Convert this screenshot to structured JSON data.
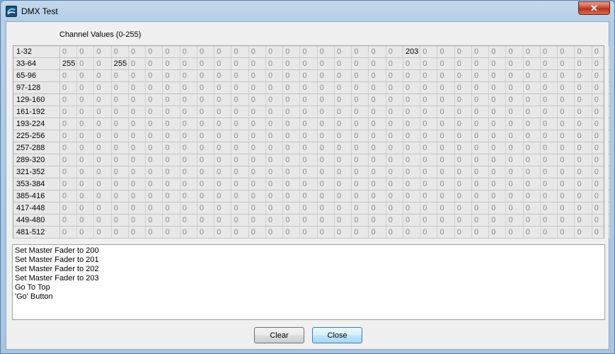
{
  "window": {
    "title": "DMX Test",
    "close_symbol": "✕"
  },
  "grid": {
    "caption": "Channel Values (0-255)",
    "rows": [
      {
        "label": "1-32",
        "values": [
          "0",
          "0",
          "0",
          "0",
          "0",
          "0",
          "0",
          "0",
          "0",
          "0",
          "0",
          "0",
          "0",
          "0",
          "0",
          "0",
          "0",
          "0",
          "0",
          "0",
          "203",
          "0",
          "0",
          "0",
          "0",
          "0",
          "0",
          "0",
          "0",
          "0",
          "0",
          "0"
        ]
      },
      {
        "label": "33-64",
        "values": [
          "255",
          "0",
          "0",
          "255",
          "0",
          "0",
          "0",
          "0",
          "0",
          "0",
          "0",
          "0",
          "0",
          "0",
          "0",
          "0",
          "0",
          "0",
          "0",
          "0",
          "0",
          "0",
          "0",
          "0",
          "0",
          "0",
          "0",
          "0",
          "0",
          "0",
          "0",
          "0"
        ]
      },
      {
        "label": "65-96",
        "values": [
          "0",
          "0",
          "0",
          "0",
          "0",
          "0",
          "0",
          "0",
          "0",
          "0",
          "0",
          "0",
          "0",
          "0",
          "0",
          "0",
          "0",
          "0",
          "0",
          "0",
          "0",
          "0",
          "0",
          "0",
          "0",
          "0",
          "0",
          "0",
          "0",
          "0",
          "0",
          "0"
        ]
      },
      {
        "label": "97-128",
        "values": [
          "0",
          "0",
          "0",
          "0",
          "0",
          "0",
          "0",
          "0",
          "0",
          "0",
          "0",
          "0",
          "0",
          "0",
          "0",
          "0",
          "0",
          "0",
          "0",
          "0",
          "0",
          "0",
          "0",
          "0",
          "0",
          "0",
          "0",
          "0",
          "0",
          "0",
          "0",
          "0"
        ]
      },
      {
        "label": "129-160",
        "values": [
          "0",
          "0",
          "0",
          "0",
          "0",
          "0",
          "0",
          "0",
          "0",
          "0",
          "0",
          "0",
          "0",
          "0",
          "0",
          "0",
          "0",
          "0",
          "0",
          "0",
          "0",
          "0",
          "0",
          "0",
          "0",
          "0",
          "0",
          "0",
          "0",
          "0",
          "0",
          "0"
        ]
      },
      {
        "label": "161-192",
        "values": [
          "0",
          "0",
          "0",
          "0",
          "0",
          "0",
          "0",
          "0",
          "0",
          "0",
          "0",
          "0",
          "0",
          "0",
          "0",
          "0",
          "0",
          "0",
          "0",
          "0",
          "0",
          "0",
          "0",
          "0",
          "0",
          "0",
          "0",
          "0",
          "0",
          "0",
          "0",
          "0"
        ]
      },
      {
        "label": "193-224",
        "values": [
          "0",
          "0",
          "0",
          "0",
          "0",
          "0",
          "0",
          "0",
          "0",
          "0",
          "0",
          "0",
          "0",
          "0",
          "0",
          "0",
          "0",
          "0",
          "0",
          "0",
          "0",
          "0",
          "0",
          "0",
          "0",
          "0",
          "0",
          "0",
          "0",
          "0",
          "0",
          "0"
        ]
      },
      {
        "label": "225-256",
        "values": [
          "0",
          "0",
          "0",
          "0",
          "0",
          "0",
          "0",
          "0",
          "0",
          "0",
          "0",
          "0",
          "0",
          "0",
          "0",
          "0",
          "0",
          "0",
          "0",
          "0",
          "0",
          "0",
          "0",
          "0",
          "0",
          "0",
          "0",
          "0",
          "0",
          "0",
          "0",
          "0"
        ]
      },
      {
        "label": "257-288",
        "values": [
          "0",
          "0",
          "0",
          "0",
          "0",
          "0",
          "0",
          "0",
          "0",
          "0",
          "0",
          "0",
          "0",
          "0",
          "0",
          "0",
          "0",
          "0",
          "0",
          "0",
          "0",
          "0",
          "0",
          "0",
          "0",
          "0",
          "0",
          "0",
          "0",
          "0",
          "0",
          "0"
        ]
      },
      {
        "label": "289-320",
        "values": [
          "0",
          "0",
          "0",
          "0",
          "0",
          "0",
          "0",
          "0",
          "0",
          "0",
          "0",
          "0",
          "0",
          "0",
          "0",
          "0",
          "0",
          "0",
          "0",
          "0",
          "0",
          "0",
          "0",
          "0",
          "0",
          "0",
          "0",
          "0",
          "0",
          "0",
          "0",
          "0"
        ]
      },
      {
        "label": "321-352",
        "values": [
          "0",
          "0",
          "0",
          "0",
          "0",
          "0",
          "0",
          "0",
          "0",
          "0",
          "0",
          "0",
          "0",
          "0",
          "0",
          "0",
          "0",
          "0",
          "0",
          "0",
          "0",
          "0",
          "0",
          "0",
          "0",
          "0",
          "0",
          "0",
          "0",
          "0",
          "0",
          "0"
        ]
      },
      {
        "label": "353-384",
        "values": [
          "0",
          "0",
          "0",
          "0",
          "0",
          "0",
          "0",
          "0",
          "0",
          "0",
          "0",
          "0",
          "0",
          "0",
          "0",
          "0",
          "0",
          "0",
          "0",
          "0",
          "0",
          "0",
          "0",
          "0",
          "0",
          "0",
          "0",
          "0",
          "0",
          "0",
          "0",
          "0"
        ]
      },
      {
        "label": "385-416",
        "values": [
          "0",
          "0",
          "0",
          "0",
          "0",
          "0",
          "0",
          "0",
          "0",
          "0",
          "0",
          "0",
          "0",
          "0",
          "0",
          "0",
          "0",
          "0",
          "0",
          "0",
          "0",
          "0",
          "0",
          "0",
          "0",
          "0",
          "0",
          "0",
          "0",
          "0",
          "0",
          "0"
        ]
      },
      {
        "label": "417-448",
        "values": [
          "0",
          "0",
          "0",
          "0",
          "0",
          "0",
          "0",
          "0",
          "0",
          "0",
          "0",
          "0",
          "0",
          "0",
          "0",
          "0",
          "0",
          "0",
          "0",
          "0",
          "0",
          "0",
          "0",
          "0",
          "0",
          "0",
          "0",
          "0",
          "0",
          "0",
          "0",
          "0"
        ]
      },
      {
        "label": "449-480",
        "values": [
          "0",
          "0",
          "0",
          "0",
          "0",
          "0",
          "0",
          "0",
          "0",
          "0",
          "0",
          "0",
          "0",
          "0",
          "0",
          "0",
          "0",
          "0",
          "0",
          "0",
          "0",
          "0",
          "0",
          "0",
          "0",
          "0",
          "0",
          "0",
          "0",
          "0",
          "0",
          "0"
        ]
      },
      {
        "label": "481-512",
        "values": [
          "0",
          "0",
          "0",
          "0",
          "0",
          "0",
          "0",
          "0",
          "0",
          "0",
          "0",
          "0",
          "0",
          "0",
          "0",
          "0",
          "0",
          "0",
          "0",
          "0",
          "0",
          "0",
          "0",
          "0",
          "0",
          "0",
          "0",
          "0",
          "0",
          "0",
          "0",
          "0"
        ]
      }
    ]
  },
  "log": {
    "lines": [
      "Set Master Fader to 200",
      "Set Master Fader to 201",
      "Set Master Fader to 202",
      "Set Master Fader to 203",
      "Go To Top",
      "'Go' Button"
    ]
  },
  "buttons": {
    "clear_label": "Clear",
    "close_label": "Close"
  },
  "colors": {
    "inactive_value": "#8a8a8a",
    "active_value": "#000000"
  }
}
